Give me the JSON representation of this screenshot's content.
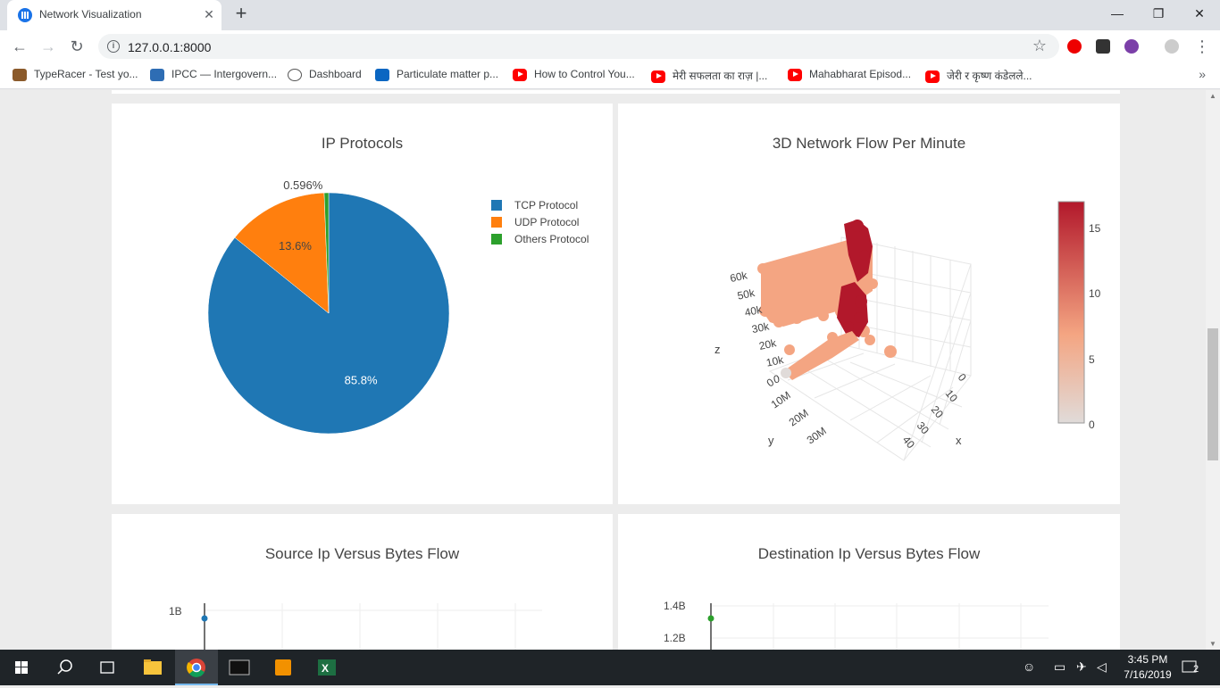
{
  "browser": {
    "tab_title": "Network Visualization",
    "url": "127.0.0.1:8000",
    "new_tab_symbol": "+",
    "close_symbol": "✕"
  },
  "bookmarks": [
    {
      "label": "TypeRacer - Test yo...",
      "icon": "typeracer-icon"
    },
    {
      "label": "IPCC — Intergovern...",
      "icon": "ipcc-icon"
    },
    {
      "label": "Dashboard",
      "icon": "dashboard-icon"
    },
    {
      "label": "Particulate matter p...",
      "icon": "linkedin-icon"
    },
    {
      "label": "How to Control You...",
      "icon": "youtube-icon"
    },
    {
      "label": "मेरी सफलता का राज़ |...",
      "icon": "youtube-icon"
    },
    {
      "label": "Mahabharat Episod...",
      "icon": "youtube-icon"
    },
    {
      "label": "जेरी र कृष्ण कंडेलले...",
      "icon": "youtube-icon"
    }
  ],
  "charts": {
    "pie": {
      "title": "IP Protocols"
    },
    "scatter3d": {
      "title": "3D Network Flow Per Minute",
      "z_ticks": [
        "60k",
        "50k",
        "40k",
        "30k",
        "20k",
        "10k",
        "0"
      ],
      "y_ticks": [
        "0",
        "10M",
        "20M",
        "30M"
      ],
      "x_ticks": [
        "0",
        "10",
        "20",
        "30",
        "40"
      ],
      "xlabel": "x",
      "ylabel": "y",
      "zlabel": "z",
      "colorbar_ticks": [
        "15",
        "10",
        "5",
        "0"
      ],
      "colorbar_range": [
        0,
        17
      ],
      "colorscale": [
        "#e0dbd9",
        "#f4a582",
        "#b2182b"
      ]
    },
    "source": {
      "title": "Source Ip Versus Bytes Flow",
      "y_tick": "1B",
      "marker_color": "#1f77b4"
    },
    "destination": {
      "title": "Destination Ip Versus Bytes Flow",
      "y_ticks": [
        "1.4B",
        "1.2B"
      ],
      "marker_color": "#2ca02c"
    }
  },
  "chart_data": [
    {
      "type": "pie",
      "title": "IP Protocols",
      "labels": [
        "TCP Protocol",
        "UDP Protocol",
        "Others Protocol"
      ],
      "values": [
        85.8,
        13.6,
        0.596
      ],
      "value_labels": [
        "85.8%",
        "13.6%",
        "0.596%"
      ],
      "colors": [
        "#1f77b4",
        "#ff7f0e",
        "#2ca02c"
      ],
      "legend": "right"
    },
    {
      "type": "scatter",
      "title": "Source Ip Versus Bytes Flow",
      "y_ticks": [
        "1B"
      ]
    },
    {
      "type": "scatter",
      "title": "Destination Ip Versus Bytes Flow",
      "y_ticks": [
        "1.4B",
        "1.2B"
      ]
    }
  ],
  "taskbar": {
    "time": "3:45 PM",
    "date": "7/16/2019",
    "notification_count": "2"
  }
}
